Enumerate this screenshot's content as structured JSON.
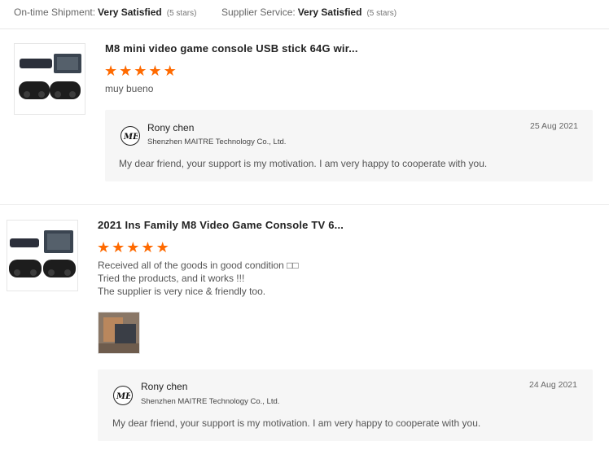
{
  "ratings": {
    "shipment": {
      "label": "On-time Shipment:",
      "value": "Very Satisfied",
      "note": "(5 stars)"
    },
    "service": {
      "label": "Supplier Service:",
      "value": "Very Satisfied",
      "note": "(5 stars)"
    }
  },
  "reviews": [
    {
      "title": "M8 mini video game console USB stick 64G wir...",
      "stars": 5,
      "text": [
        "muy bueno"
      ],
      "reply": {
        "name": "Rony chen",
        "company": "Shenzhen MAITRE Technology Co., Ltd.",
        "date": "25 Aug 2021",
        "message": "My dear friend, your support is my motivation. I am very happy to cooperate with you."
      }
    },
    {
      "title": "2021 Ins Family M8 Video Game Console TV 6...",
      "stars": 5,
      "text": [
        "Received all of the goods in good condition □□",
        "Tried the products, and it works !!!",
        "The supplier is very nice & friendly too."
      ],
      "reply": {
        "name": "Rony chen",
        "company": "Shenzhen MAITRE Technology Co., Ltd.",
        "date": "24 Aug 2021",
        "message": "My dear friend, your support is my motivation. I am very happy to cooperate with you."
      }
    }
  ],
  "colors": {
    "star": "#ff6a00",
    "reply_bg": "#f6f6f6"
  },
  "icons": {
    "star": "star-icon",
    "logo": "maitre-logo-icon"
  }
}
